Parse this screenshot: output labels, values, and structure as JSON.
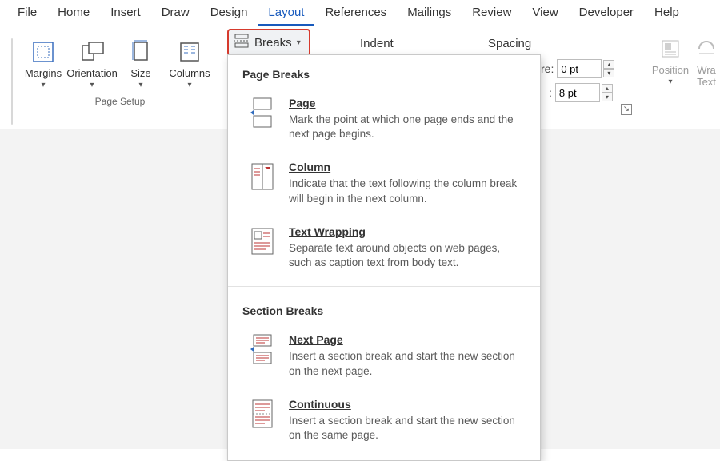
{
  "menubar": {
    "items": [
      "File",
      "Home",
      "Insert",
      "Draw",
      "Design",
      "Layout",
      "References",
      "Mailings",
      "Review",
      "View",
      "Developer",
      "Help"
    ],
    "activeIndex": 5
  },
  "ribbon": {
    "page_setup": {
      "label": "Page Setup",
      "buttons": [
        "Margins",
        "Orientation",
        "Size",
        "Columns"
      ]
    },
    "breaks_label": "Breaks",
    "indent_label": "Indent",
    "spacing_label": "Spacing",
    "before": {
      "label": "re:",
      "value": "0 pt"
    },
    "after": {
      "label": ":",
      "value": "8 pt"
    },
    "arrange": {
      "position": "Position",
      "wrap": "Wra",
      "wrap2": "Text"
    }
  },
  "dropdown": {
    "sec1_title": "Page Breaks",
    "sec2_title": "Section Breaks",
    "items1": [
      {
        "title": "Page",
        "desc": "Mark the point at which one page ends and the next page begins."
      },
      {
        "title": "Column",
        "desc": "Indicate that the text following the column break will begin in the next column."
      },
      {
        "title": "Text Wrapping",
        "desc": "Separate text around objects on web pages, such as caption text from body text."
      }
    ],
    "items2": [
      {
        "title": "Next Page",
        "desc": "Insert a section break and start the new section on the next page."
      },
      {
        "title": "Continuous",
        "desc": "Insert a section break and start the new section on the same page."
      }
    ]
  }
}
